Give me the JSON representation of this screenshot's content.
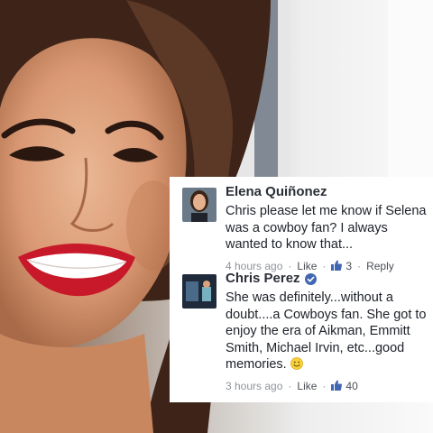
{
  "comments": [
    {
      "author": "Elena Quiñonez",
      "verified": false,
      "text": "Chris please let me know if Selena was a cowboy fan? I always wanted to know that...",
      "timestamp": "4 hours ago",
      "like_label": "Like",
      "like_count": "3",
      "reply_label": "Reply"
    },
    {
      "author": "Chris Perez",
      "verified": true,
      "text": "She was definitely...without a doubt....a Cowboys fan. She got to enjoy the era of Aikman, Emmitt Smith, Michael Irvin, etc...good memories.",
      "emoji": "smiley-emoji",
      "timestamp": "3 hours ago",
      "like_label": "Like",
      "like_count": "40"
    }
  ],
  "icons": {
    "like": "thumbs-up-icon",
    "verified": "verified-badge-icon"
  },
  "colors": {
    "author": "#2b2f38",
    "meta": "#90949c",
    "verified": "#4267b2",
    "like": "#4267b2"
  }
}
